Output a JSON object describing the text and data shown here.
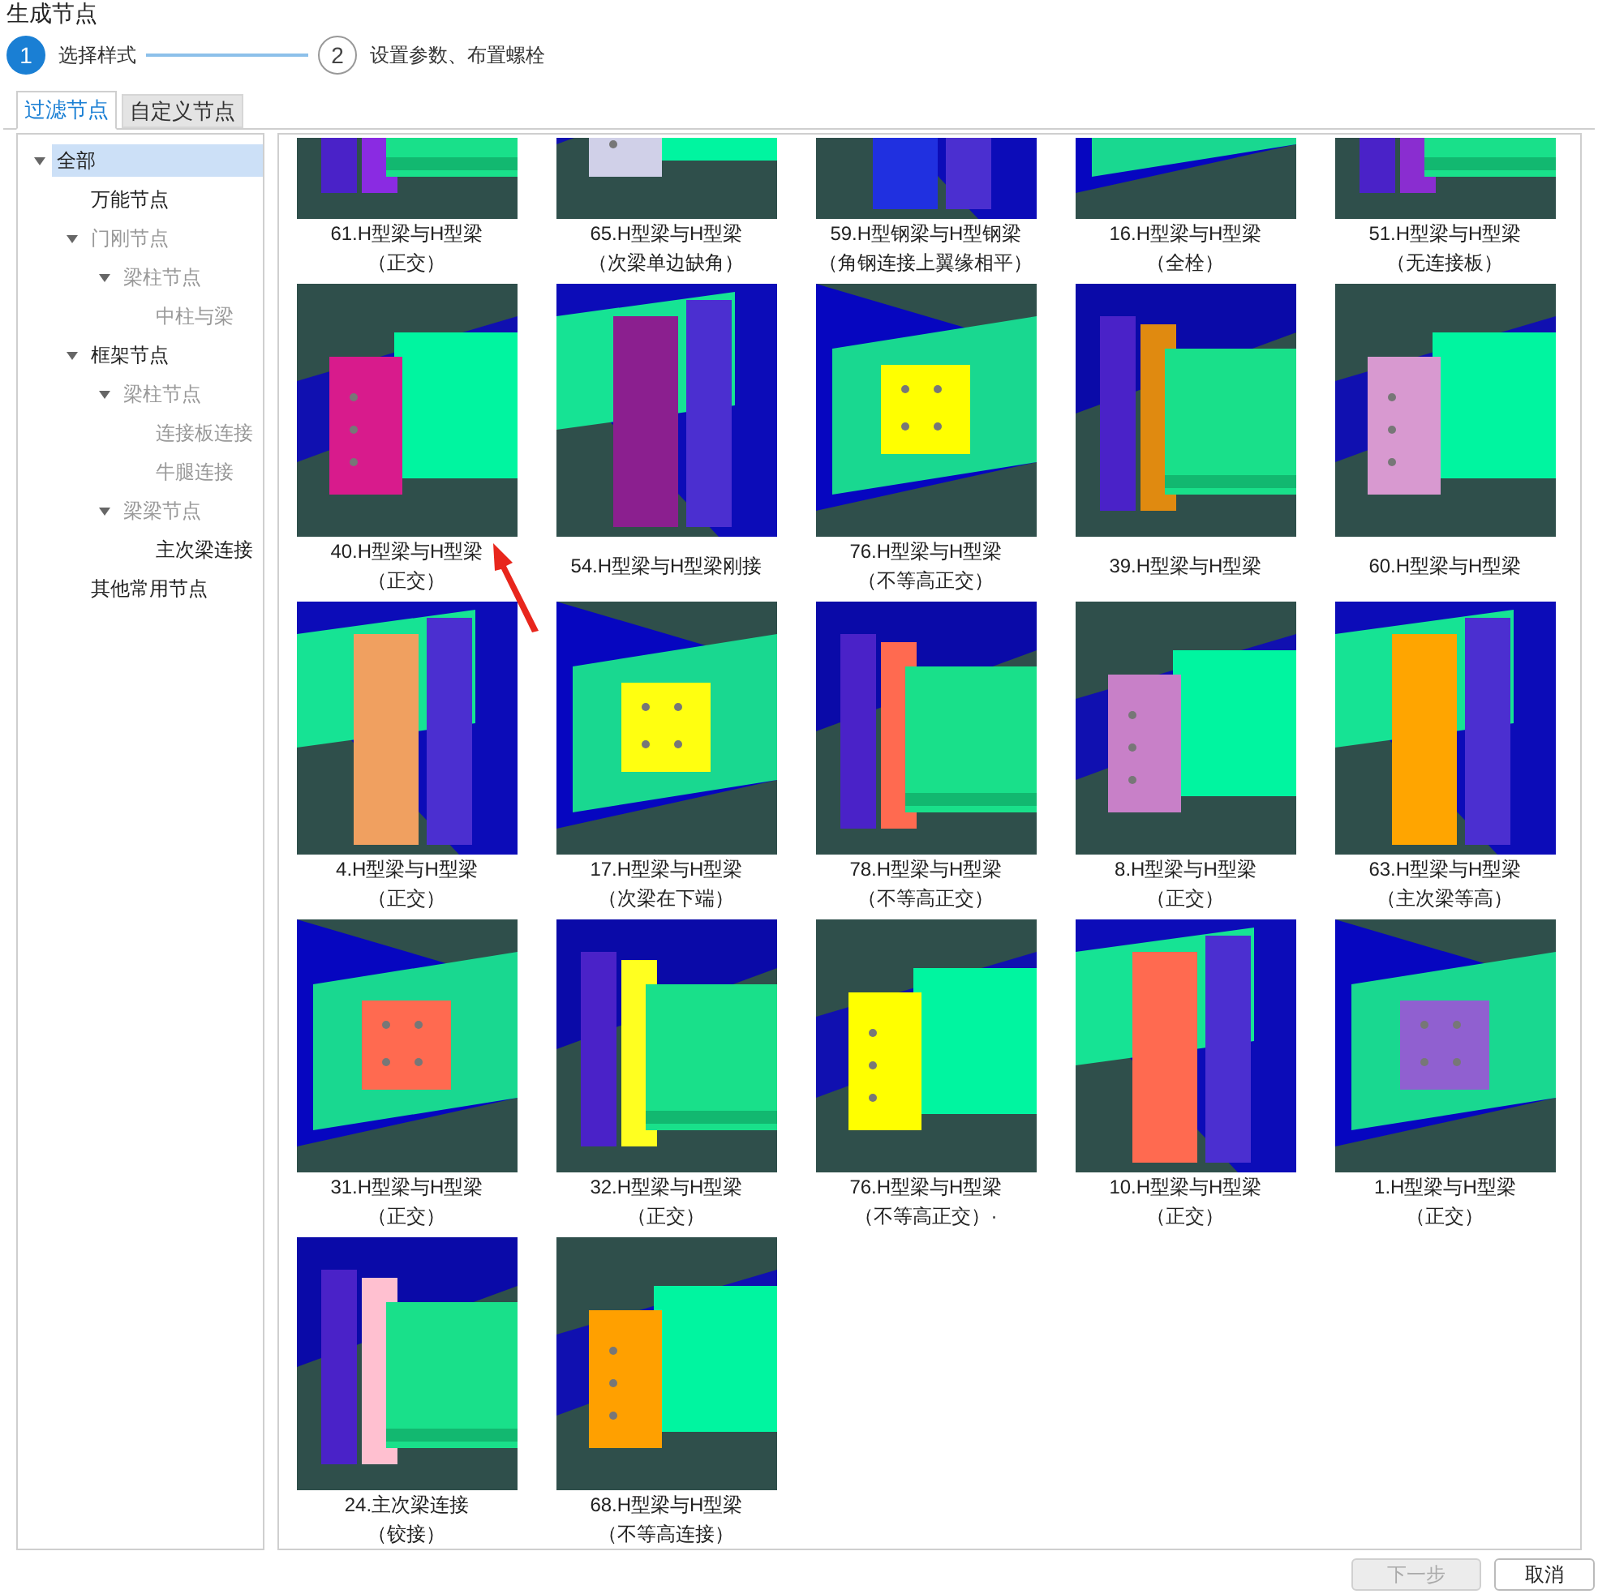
{
  "window": {
    "title": "生成节点"
  },
  "steps": [
    {
      "number": "1",
      "label": "选择样式",
      "selected": true
    },
    {
      "number": "2",
      "label": "设置参数、布置螺栓",
      "selected": false
    }
  ],
  "tabs": [
    {
      "label": "过滤节点",
      "selected": true
    },
    {
      "label": "自定义节点",
      "selected": false
    }
  ],
  "tree": [
    {
      "label": "全部",
      "selected": true,
      "disabled": false,
      "expanded": true,
      "children": [
        {
          "label": "万能节点",
          "selected": false,
          "disabled": false
        },
        {
          "label": "门刚节点",
          "selected": false,
          "disabled": true,
          "expanded": true,
          "children": [
            {
              "label": "梁柱节点",
              "selected": false,
              "disabled": true,
              "expanded": true,
              "children": [
                {
                  "label": "中柱与梁",
                  "selected": false,
                  "disabled": true
                }
              ]
            }
          ]
        },
        {
          "label": "框架节点",
          "selected": false,
          "disabled": false,
          "expanded": true,
          "children": [
            {
              "label": "梁柱节点",
              "selected": false,
              "disabled": true,
              "expanded": true,
              "children": [
                {
                  "label": "连接板连接",
                  "selected": false,
                  "disabled": true
                },
                {
                  "label": "牛腿连接",
                  "selected": false,
                  "disabled": true
                }
              ]
            },
            {
              "label": "梁梁节点",
              "selected": false,
              "disabled": true,
              "expanded": true,
              "children": [
                {
                  "label": "主次梁连接",
                  "selected": false,
                  "disabled": false
                }
              ]
            }
          ]
        },
        {
          "label": "其他常用节点",
          "selected": false,
          "disabled": false
        }
      ]
    }
  ],
  "nodes": [
    {
      "caption": [
        "61.H型梁与H型梁",
        "（正交）"
      ],
      "kind": "picture"
    },
    {
      "caption": [
        "65.H型梁与H型梁",
        "（次梁单边缺角）"
      ],
      "kind": "picture"
    },
    {
      "caption": [
        "59.H型钢梁与H型钢梁",
        "（角钢连接上翼缘相平）"
      ],
      "kind": "picture"
    },
    {
      "caption": [
        "16.H型梁与H型梁",
        "（全栓）"
      ],
      "kind": "picture"
    },
    {
      "caption": [
        "51.H型梁与H型梁",
        "（无连接板）"
      ],
      "kind": "picture"
    },
    {
      "caption": [
        "40.H型梁与H型梁",
        "（正交）"
      ],
      "kind": "picture"
    },
    {
      "caption": [
        "54.H型梁与H型梁刚接"
      ],
      "kind": "picture"
    },
    {
      "caption": [
        "76.H型梁与H型梁",
        "（不等高正交）"
      ],
      "kind": "picture"
    },
    {
      "caption": [
        "39.H型梁与H型梁"
      ],
      "kind": "picture"
    },
    {
      "caption": [
        "60.H型梁与H型梁"
      ],
      "kind": "picture"
    },
    {
      "caption": [
        "4.H型梁与H型梁",
        "（正交）"
      ],
      "kind": "picture"
    },
    {
      "caption": [
        "17.H型梁与H型梁",
        "（次梁在下端）"
      ],
      "kind": "picture"
    },
    {
      "caption": [
        "78.H型梁与H型梁",
        "（不等高正交）"
      ],
      "kind": "picture"
    },
    {
      "caption": [
        "8.H型梁与H型梁",
        "（正交）"
      ],
      "kind": "picture"
    },
    {
      "caption": [
        "63.H型梁与H型梁",
        "（主次梁等高）"
      ],
      "kind": "picture"
    },
    {
      "caption": [
        "31.H型梁与H型梁",
        "（正交）"
      ],
      "kind": "picture"
    },
    {
      "caption": [
        "32.H型梁与H型梁",
        "（正交）"
      ],
      "kind": "picture"
    },
    {
      "caption": [
        "76.H型梁与H型梁",
        "（不等高正交）·"
      ],
      "kind": "picture"
    },
    {
      "caption": [
        "10.H型梁与H型梁",
        "（正交）"
      ],
      "kind": "picture"
    },
    {
      "caption": [
        "1.H型梁与H型梁",
        "（正交）"
      ],
      "kind": "picture"
    },
    {
      "caption": [
        "24.主次梁连接",
        "（铰接）"
      ],
      "kind": "picture"
    },
    {
      "caption": [
        "68.H型梁与H型梁",
        "（不等高连接）"
      ],
      "kind": "picture"
    }
  ],
  "buttons": [
    {
      "label": "下一步",
      "disabled": true
    },
    {
      "label": "取消",
      "disabled": false
    }
  ]
}
